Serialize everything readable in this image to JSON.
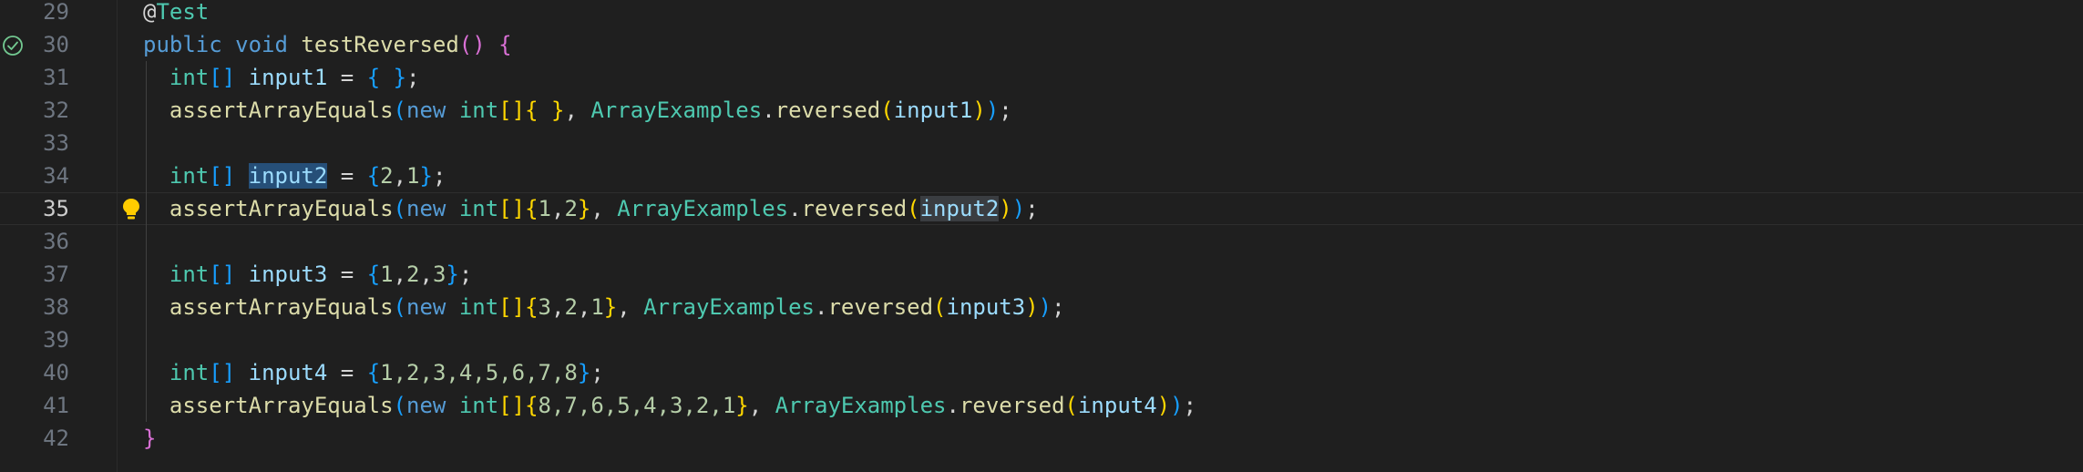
{
  "editor": {
    "lines": [
      {
        "number": "29",
        "tokens": [
          {
            "text": "@",
            "cls": "at"
          },
          {
            "text": "Test",
            "cls": "ann"
          }
        ]
      },
      {
        "number": "30",
        "tokens": [
          {
            "text": "public",
            "cls": "kw"
          },
          {
            "text": " ",
            "cls": "punc"
          },
          {
            "text": "void",
            "cls": "kw"
          },
          {
            "text": " ",
            "cls": "punc"
          },
          {
            "text": "testReversed",
            "cls": "fn"
          },
          {
            "text": "()",
            "cls": "br2"
          },
          {
            "text": " ",
            "cls": "punc"
          },
          {
            "text": "{",
            "cls": "br2"
          }
        ]
      },
      {
        "number": "31",
        "tokens": [
          {
            "text": "  ",
            "cls": "punc"
          },
          {
            "text": "int",
            "cls": "type"
          },
          {
            "text": "[]",
            "cls": "br3"
          },
          {
            "text": " ",
            "cls": "punc"
          },
          {
            "text": "input1",
            "cls": "var"
          },
          {
            "text": " = ",
            "cls": "punc"
          },
          {
            "text": "{ }",
            "cls": "br3"
          },
          {
            "text": ";",
            "cls": "punc"
          }
        ]
      },
      {
        "number": "32",
        "tokens": [
          {
            "text": "  ",
            "cls": "punc"
          },
          {
            "text": "assertArrayEquals",
            "cls": "fn"
          },
          {
            "text": "(",
            "cls": "br3"
          },
          {
            "text": "new",
            "cls": "kw"
          },
          {
            "text": " ",
            "cls": "punc"
          },
          {
            "text": "int",
            "cls": "type"
          },
          {
            "text": "[]",
            "cls": "br1"
          },
          {
            "text": "{ }",
            "cls": "br1"
          },
          {
            "text": ", ",
            "cls": "punc"
          },
          {
            "text": "ArrayExamples",
            "cls": "type"
          },
          {
            "text": ".",
            "cls": "punc"
          },
          {
            "text": "reversed",
            "cls": "fn"
          },
          {
            "text": "(",
            "cls": "br1"
          },
          {
            "text": "input1",
            "cls": "var"
          },
          {
            "text": ")",
            "cls": "br1"
          },
          {
            "text": ")",
            "cls": "br3"
          },
          {
            "text": ";",
            "cls": "punc"
          }
        ]
      },
      {
        "number": "33",
        "tokens": []
      },
      {
        "number": "34",
        "tokens": [
          {
            "text": "  ",
            "cls": "punc"
          },
          {
            "text": "int",
            "cls": "type"
          },
          {
            "text": "[]",
            "cls": "br3"
          },
          {
            "text": " ",
            "cls": "punc"
          },
          {
            "text": "input2",
            "cls": "var hl-sel"
          },
          {
            "text": " = ",
            "cls": "punc"
          },
          {
            "text": "{",
            "cls": "br3"
          },
          {
            "text": "2",
            "cls": "num"
          },
          {
            "text": ",",
            "cls": "punc"
          },
          {
            "text": "1",
            "cls": "num"
          },
          {
            "text": "}",
            "cls": "br3"
          },
          {
            "text": ";",
            "cls": "punc"
          }
        ]
      },
      {
        "number": "35",
        "current": true,
        "tokens": [
          {
            "text": "  ",
            "cls": "punc"
          },
          {
            "text": "assertArrayEquals",
            "cls": "fn"
          },
          {
            "text": "(",
            "cls": "br3"
          },
          {
            "text": "new",
            "cls": "kw"
          },
          {
            "text": " ",
            "cls": "punc"
          },
          {
            "text": "int",
            "cls": "type"
          },
          {
            "text": "[]",
            "cls": "br1"
          },
          {
            "text": "{",
            "cls": "br1"
          },
          {
            "text": "1",
            "cls": "num"
          },
          {
            "text": ",",
            "cls": "punc"
          },
          {
            "text": "2",
            "cls": "num"
          },
          {
            "text": "}",
            "cls": "br1"
          },
          {
            "text": ", ",
            "cls": "punc"
          },
          {
            "text": "ArrayExamples",
            "cls": "type"
          },
          {
            "text": ".",
            "cls": "punc"
          },
          {
            "text": "reversed",
            "cls": "fn"
          },
          {
            "text": "(",
            "cls": "br1"
          },
          {
            "text": "input2",
            "cls": "var hl-occ"
          },
          {
            "text": ")",
            "cls": "br1"
          },
          {
            "text": ")",
            "cls": "br3"
          },
          {
            "text": ";",
            "cls": "punc"
          }
        ]
      },
      {
        "number": "36",
        "tokens": []
      },
      {
        "number": "37",
        "tokens": [
          {
            "text": "  ",
            "cls": "punc"
          },
          {
            "text": "int",
            "cls": "type"
          },
          {
            "text": "[]",
            "cls": "br3"
          },
          {
            "text": " ",
            "cls": "punc"
          },
          {
            "text": "input3",
            "cls": "var"
          },
          {
            "text": " = ",
            "cls": "punc"
          },
          {
            "text": "{",
            "cls": "br3"
          },
          {
            "text": "1",
            "cls": "num"
          },
          {
            "text": ",",
            "cls": "punc"
          },
          {
            "text": "2",
            "cls": "num"
          },
          {
            "text": ",",
            "cls": "punc"
          },
          {
            "text": "3",
            "cls": "num"
          },
          {
            "text": "}",
            "cls": "br3"
          },
          {
            "text": ";",
            "cls": "punc"
          }
        ]
      },
      {
        "number": "38",
        "tokens": [
          {
            "text": "  ",
            "cls": "punc"
          },
          {
            "text": "assertArrayEquals",
            "cls": "fn"
          },
          {
            "text": "(",
            "cls": "br3"
          },
          {
            "text": "new",
            "cls": "kw"
          },
          {
            "text": " ",
            "cls": "punc"
          },
          {
            "text": "int",
            "cls": "type"
          },
          {
            "text": "[]",
            "cls": "br1"
          },
          {
            "text": "{",
            "cls": "br1"
          },
          {
            "text": "3",
            "cls": "num"
          },
          {
            "text": ",",
            "cls": "punc"
          },
          {
            "text": "2",
            "cls": "num"
          },
          {
            "text": ",",
            "cls": "punc"
          },
          {
            "text": "1",
            "cls": "num"
          },
          {
            "text": "}",
            "cls": "br1"
          },
          {
            "text": ", ",
            "cls": "punc"
          },
          {
            "text": "ArrayExamples",
            "cls": "type"
          },
          {
            "text": ".",
            "cls": "punc"
          },
          {
            "text": "reversed",
            "cls": "fn"
          },
          {
            "text": "(",
            "cls": "br1"
          },
          {
            "text": "input3",
            "cls": "var"
          },
          {
            "text": ")",
            "cls": "br1"
          },
          {
            "text": ")",
            "cls": "br3"
          },
          {
            "text": ";",
            "cls": "punc"
          }
        ]
      },
      {
        "number": "39",
        "tokens": []
      },
      {
        "number": "40",
        "tokens": [
          {
            "text": "  ",
            "cls": "punc"
          },
          {
            "text": "int",
            "cls": "type"
          },
          {
            "text": "[]",
            "cls": "br3"
          },
          {
            "text": " ",
            "cls": "punc"
          },
          {
            "text": "input4",
            "cls": "var"
          },
          {
            "text": " = ",
            "cls": "punc"
          },
          {
            "text": "{",
            "cls": "br3"
          },
          {
            "text": "1,2,3,4,5,6,7,8",
            "cls": "num"
          },
          {
            "text": "}",
            "cls": "br3"
          },
          {
            "text": ";",
            "cls": "punc"
          }
        ]
      },
      {
        "number": "41",
        "tokens": [
          {
            "text": "  ",
            "cls": "punc"
          },
          {
            "text": "assertArrayEquals",
            "cls": "fn"
          },
          {
            "text": "(",
            "cls": "br3"
          },
          {
            "text": "new",
            "cls": "kw"
          },
          {
            "text": " ",
            "cls": "punc"
          },
          {
            "text": "int",
            "cls": "type"
          },
          {
            "text": "[]",
            "cls": "br1"
          },
          {
            "text": "{",
            "cls": "br1"
          },
          {
            "text": "8,7,6,5,4,3,2,1",
            "cls": "num"
          },
          {
            "text": "}",
            "cls": "br1"
          },
          {
            "text": ", ",
            "cls": "punc"
          },
          {
            "text": "ArrayExamples",
            "cls": "type"
          },
          {
            "text": ".",
            "cls": "punc"
          },
          {
            "text": "reversed",
            "cls": "fn"
          },
          {
            "text": "(",
            "cls": "br1"
          },
          {
            "text": "input4",
            "cls": "var"
          },
          {
            "text": ")",
            "cls": "br1"
          },
          {
            "text": ")",
            "cls": "br3"
          },
          {
            "text": ";",
            "cls": "punc"
          }
        ]
      },
      {
        "number": "42",
        "tokens": [
          {
            "text": "}",
            "cls": "br2"
          }
        ]
      }
    ],
    "test_status_line": "30",
    "lightbulb_line": "35",
    "colors": {
      "background": "#1f1f1f",
      "keyword": "#569cd6",
      "type": "#4ec9b0",
      "function": "#dcdcaa",
      "variable": "#9cdcfe",
      "number": "#b5cea8",
      "test_pass": "#73c991",
      "lightbulb": "#ffcc00"
    },
    "icons": {
      "test_status": "check-circle-icon",
      "code_action": "lightbulb-icon"
    }
  }
}
